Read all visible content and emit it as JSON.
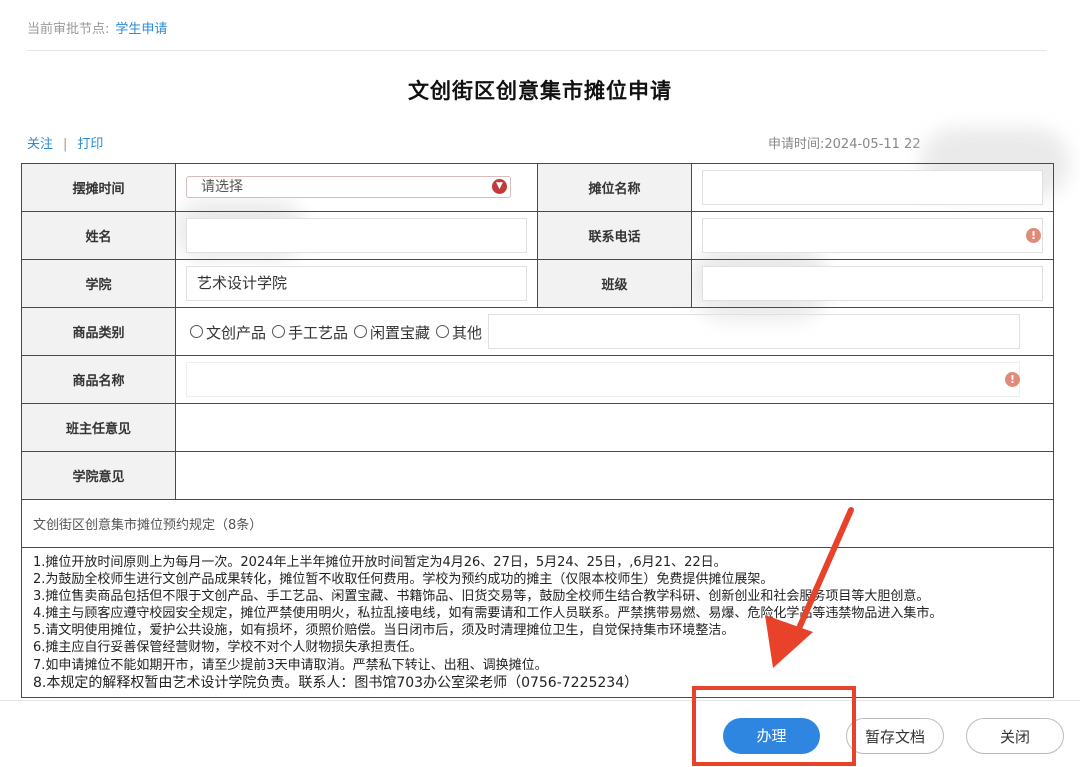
{
  "breadcrumb": {
    "label": "当前审批节点:",
    "node": "学生申请"
  },
  "page_title": "文创街区创意集市摊位申请",
  "actions": {
    "follow": "关注",
    "separator": "|",
    "print": "打印"
  },
  "apply_time": "申请时间:2024-05-11 22",
  "form": {
    "stall_time": {
      "label": "摆摊时间",
      "placeholder": "请选择"
    },
    "stall_name": {
      "label": "摊位名称",
      "value": ""
    },
    "name": {
      "label": "姓名",
      "value": ""
    },
    "phone": {
      "label": "联系电话",
      "value": ""
    },
    "college": {
      "label": "学院",
      "value": "艺术设计学院"
    },
    "class": {
      "label": "班级",
      "value": ""
    },
    "category": {
      "label": "商品类别",
      "options": [
        "文创产品",
        "手工艺品",
        "闲置宝藏",
        "其他"
      ]
    },
    "product_name": {
      "label": "商品名称",
      "value": ""
    },
    "teacher_opinion": {
      "label": "班主任意见"
    },
    "college_opinion": {
      "label": "学院意见"
    }
  },
  "rules": {
    "title": "文创街区创意集市摊位预约规定（8条）",
    "items": [
      "1.摊位开放时间原则上为每月一次。2024年上半年摊位开放时间暂定为4月26、27日，5月24、25日，,6月21、22日。",
      "2.为鼓励全校师生进行文创产品成果转化，摊位暂不收取任何费用。学校为预约成功的摊主（仅限本校师生）免费提供摊位展架。",
      "3.摊位售卖商品包括但不限于文创产品、手工艺品、闲置宝藏、书籍饰品、旧货交易等，鼓励全校师生结合教学科研、创新创业和社会服务项目等大胆创意。",
      "4.摊主与顾客应遵守校园安全规定，摊位严禁使用明火，私拉乱接电线，如有需要请和工作人员联系。严禁携带易燃、易爆、危险化学品等违禁物品进入集市。",
      "5.请文明使用摊位，爱护公共设施，如有损坏，须照价赔偿。当日闭市后，须及时清理摊位卫生，自觉保持集市环境整洁。",
      "6.摊主应自行妥善保管经营财物，学校不对个人财物损失承担责任。",
      "7.如申请摊位不能如期开市，请至少提前3天申请取消。严禁私下转让、出租、调换摊位。",
      "8.本规定的解释权暂由艺术设计学院负责。联系人：图书馆703办公室梁老师（0756-7225234）"
    ]
  },
  "buttons": {
    "submit": "办理",
    "save_draft": "暂存文档",
    "close": "关闭"
  },
  "icons": {
    "dropdown": "chevron-down-icon",
    "error": "error-icon",
    "highlight_color": "#e8432a",
    "primary_color": "#2f86e0"
  }
}
